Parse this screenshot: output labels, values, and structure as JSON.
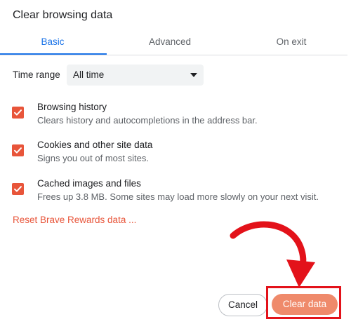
{
  "dialog": {
    "title": "Clear browsing data"
  },
  "tabs": [
    {
      "label": "Basic",
      "active": true
    },
    {
      "label": "Advanced",
      "active": false
    },
    {
      "label": "On exit",
      "active": false
    }
  ],
  "time_range": {
    "label": "Time range",
    "value": "All time"
  },
  "options": [
    {
      "title": "Browsing history",
      "description": "Clears history and autocompletions in the address bar.",
      "checked": true
    },
    {
      "title": "Cookies and other site data",
      "description": "Signs you out of most sites.",
      "checked": true
    },
    {
      "title": "Cached images and files",
      "description": "Frees up 3.8 MB. Some sites may load more slowly on your next visit.",
      "checked": true
    }
  ],
  "reset_link": "Reset Brave Rewards data ...",
  "buttons": {
    "cancel": "Cancel",
    "clear": "Clear data"
  },
  "colors": {
    "accent": "#1a73e8",
    "brand": "#e8553a",
    "clear_button": "#ef8a6b",
    "annotation": "#e3121a"
  },
  "annotations": {
    "arrow": "curved-arrow-icon",
    "highlight": "red-highlight-box"
  }
}
